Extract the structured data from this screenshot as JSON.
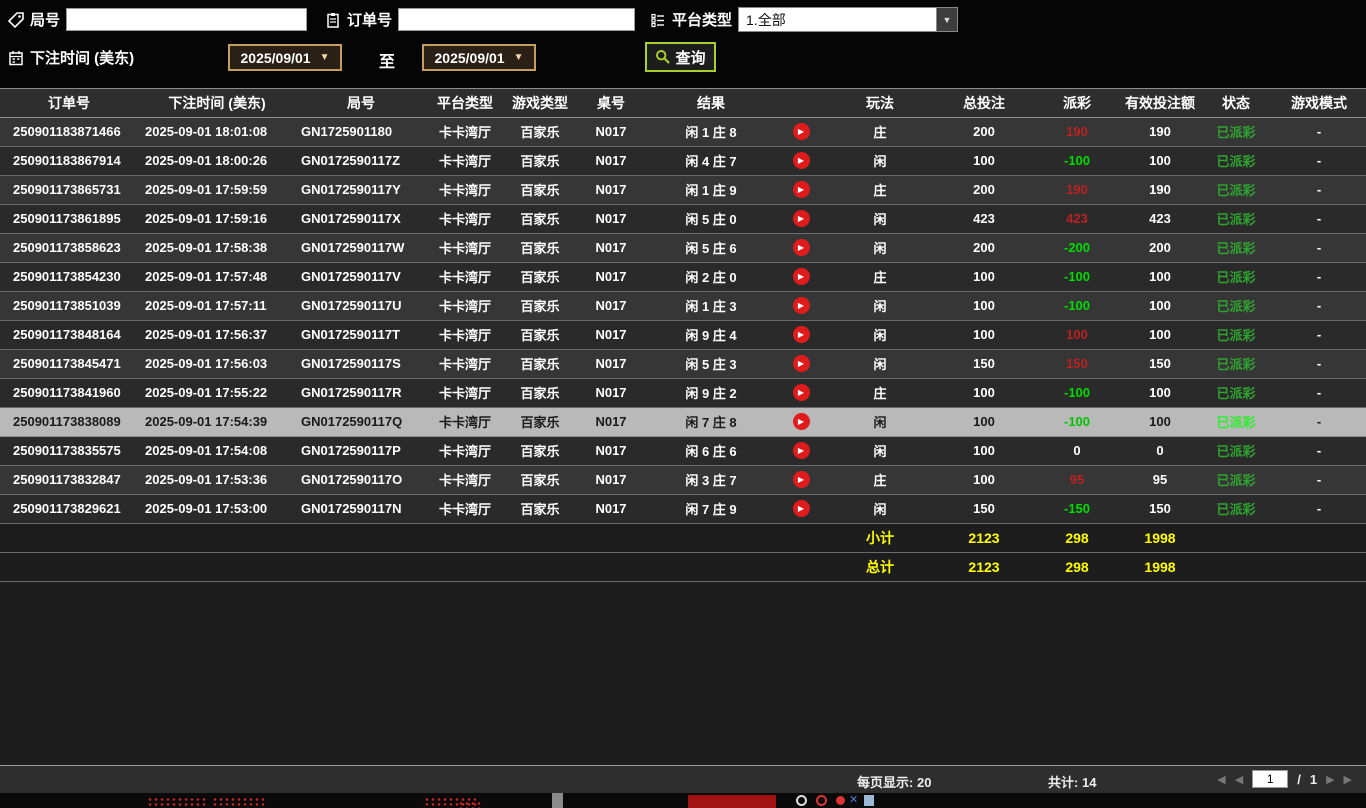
{
  "filters": {
    "round_label": "局号",
    "round_value": "",
    "order_label": "订单号",
    "order_value": "",
    "platform_label": "平台类型",
    "platform_value": "1.全部",
    "bettime_label": "下注时间 (美东)",
    "date_from": "2025/09/01",
    "to_label": "至",
    "date_to": "2025/09/01",
    "search_label": "查询"
  },
  "glyphs": {
    "dropdown": "▼",
    "play": "▶",
    "first": "◀",
    "prev": "◀",
    "next": "▶",
    "last": "▶"
  },
  "colors": {
    "payout_win": "#bb2222",
    "payout_loss": "#00dd00",
    "status_paid": "#2fa32f",
    "summary_text": "#ffff00",
    "selected_row_bg": "#b9b9b9",
    "search_border": "#a9cf2a",
    "date_border": "#c59d5f"
  },
  "table": {
    "headers": [
      "订单号",
      "下注时间 (美东)",
      "局号",
      "平台类型",
      "游戏类型",
      "桌号",
      "结果",
      "",
      "玩法",
      "总投注",
      "派彩",
      "有效投注额",
      "状态",
      "游戏模式"
    ],
    "rows": [
      {
        "order": "250901183871466",
        "time": "2025-09-01 18:01:08",
        "round": "GN1725901180",
        "platform": "卡卡湾厅",
        "game": "百家乐",
        "table_no": "N017",
        "result": "闲 1 庄 8",
        "play": "庄",
        "total": "200",
        "payout": "190",
        "payout_color": "red",
        "valid": "190",
        "status": "已派彩",
        "mode": "-",
        "selected": false
      },
      {
        "order": "250901183867914",
        "time": "2025-09-01 18:00:26",
        "round": "GN0172590117Z",
        "platform": "卡卡湾厅",
        "game": "百家乐",
        "table_no": "N017",
        "result": "闲 4 庄 7",
        "play": "闲",
        "total": "100",
        "payout": "-100",
        "payout_color": "green",
        "valid": "100",
        "status": "已派彩",
        "mode": "-",
        "selected": false
      },
      {
        "order": "250901173865731",
        "time": "2025-09-01 17:59:59",
        "round": "GN0172590117Y",
        "platform": "卡卡湾厅",
        "game": "百家乐",
        "table_no": "N017",
        "result": "闲 1 庄 9",
        "play": "庄",
        "total": "200",
        "payout": "190",
        "payout_color": "red",
        "valid": "190",
        "status": "已派彩",
        "mode": "-",
        "selected": false
      },
      {
        "order": "250901173861895",
        "time": "2025-09-01 17:59:16",
        "round": "GN0172590117X",
        "platform": "卡卡湾厅",
        "game": "百家乐",
        "table_no": "N017",
        "result": "闲 5 庄 0",
        "play": "闲",
        "total": "423",
        "payout": "423",
        "payout_color": "red",
        "valid": "423",
        "status": "已派彩",
        "mode": "-",
        "selected": false
      },
      {
        "order": "250901173858623",
        "time": "2025-09-01 17:58:38",
        "round": "GN0172590117W",
        "platform": "卡卡湾厅",
        "game": "百家乐",
        "table_no": "N017",
        "result": "闲 5 庄 6",
        "play": "闲",
        "total": "200",
        "payout": "-200",
        "payout_color": "green",
        "valid": "200",
        "status": "已派彩",
        "mode": "-",
        "selected": false
      },
      {
        "order": "250901173854230",
        "time": "2025-09-01 17:57:48",
        "round": "GN0172590117V",
        "platform": "卡卡湾厅",
        "game": "百家乐",
        "table_no": "N017",
        "result": "闲 2 庄 0",
        "play": "庄",
        "total": "100",
        "payout": "-100",
        "payout_color": "green",
        "valid": "100",
        "status": "已派彩",
        "mode": "-",
        "selected": false
      },
      {
        "order": "250901173851039",
        "time": "2025-09-01 17:57:11",
        "round": "GN0172590117U",
        "platform": "卡卡湾厅",
        "game": "百家乐",
        "table_no": "N017",
        "result": "闲 1 庄 3",
        "play": "闲",
        "total": "100",
        "payout": "-100",
        "payout_color": "green",
        "valid": "100",
        "status": "已派彩",
        "mode": "-",
        "selected": false
      },
      {
        "order": "250901173848164",
        "time": "2025-09-01 17:56:37",
        "round": "GN0172590117T",
        "platform": "卡卡湾厅",
        "game": "百家乐",
        "table_no": "N017",
        "result": "闲 9 庄 4",
        "play": "闲",
        "total": "100",
        "payout": "100",
        "payout_color": "red",
        "valid": "100",
        "status": "已派彩",
        "mode": "-",
        "selected": false
      },
      {
        "order": "250901173845471",
        "time": "2025-09-01 17:56:03",
        "round": "GN0172590117S",
        "platform": "卡卡湾厅",
        "game": "百家乐",
        "table_no": "N017",
        "result": "闲 5 庄 3",
        "play": "闲",
        "total": "150",
        "payout": "150",
        "payout_color": "red",
        "valid": "150",
        "status": "已派彩",
        "mode": "-",
        "selected": false
      },
      {
        "order": "250901173841960",
        "time": "2025-09-01 17:55:22",
        "round": "GN0172590117R",
        "platform": "卡卡湾厅",
        "game": "百家乐",
        "table_no": "N017",
        "result": "闲 9 庄 2",
        "play": "庄",
        "total": "100",
        "payout": "-100",
        "payout_color": "green",
        "valid": "100",
        "status": "已派彩",
        "mode": "-",
        "selected": false
      },
      {
        "order": "250901173838089",
        "time": "2025-09-01 17:54:39",
        "round": "GN0172590117Q",
        "platform": "卡卡湾厅",
        "game": "百家乐",
        "table_no": "N017",
        "result": "闲 7 庄 8",
        "play": "闲",
        "total": "100",
        "payout": "-100",
        "payout_color": "green",
        "valid": "100",
        "status": "已派彩",
        "mode": "-",
        "selected": true
      },
      {
        "order": "250901173835575",
        "time": "2025-09-01 17:54:08",
        "round": "GN0172590117P",
        "platform": "卡卡湾厅",
        "game": "百家乐",
        "table_no": "N017",
        "result": "闲 6 庄 6",
        "play": "闲",
        "total": "100",
        "payout": "0",
        "payout_color": "zero",
        "valid": "0",
        "status": "已派彩",
        "mode": "-",
        "selected": false
      },
      {
        "order": "250901173832847",
        "time": "2025-09-01 17:53:36",
        "round": "GN0172590117O",
        "platform": "卡卡湾厅",
        "game": "百家乐",
        "table_no": "N017",
        "result": "闲 3 庄 7",
        "play": "庄",
        "total": "100",
        "payout": "95",
        "payout_color": "red",
        "valid": "95",
        "status": "已派彩",
        "mode": "-",
        "selected": false
      },
      {
        "order": "250901173829621",
        "time": "2025-09-01 17:53:00",
        "round": "GN0172590117N",
        "platform": "卡卡湾厅",
        "game": "百家乐",
        "table_no": "N017",
        "result": "闲 7 庄 9",
        "play": "闲",
        "total": "150",
        "payout": "-150",
        "payout_color": "green",
        "valid": "150",
        "status": "已派彩",
        "mode": "-",
        "selected": false
      }
    ],
    "subtotal": {
      "label": "小计",
      "total": "2123",
      "payout": "298",
      "valid": "1998"
    },
    "total": {
      "label": "总计",
      "total": "2123",
      "payout": "298",
      "valid": "1998"
    }
  },
  "footer": {
    "per_page_label": "每页显示:",
    "per_page_value": "20",
    "total_label": "共计:",
    "total_value": "14",
    "page": "1",
    "slash": "/",
    "total_pages": "1"
  }
}
